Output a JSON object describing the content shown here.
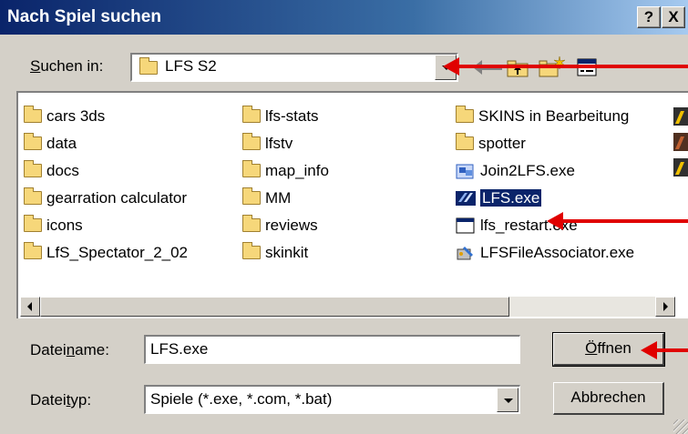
{
  "window": {
    "title": "Nach Spiel suchen",
    "help_label": "?",
    "close_label": "X"
  },
  "lookin": {
    "label_prefix": "S",
    "label_rest": "uchen in:",
    "value": "LFS S2"
  },
  "toolbar_icons": [
    "back-arrow-icon",
    "up-folder-icon",
    "new-folder-icon",
    "view-menu-icon"
  ],
  "files": {
    "col1": [
      "cars 3ds",
      "data",
      "docs",
      "gearration calculator",
      "icons",
      "LfS_Spectator_2_02"
    ],
    "col2": [
      "lfs-stats",
      "lfstv",
      "map_info",
      "MM",
      "reviews",
      "skinkit"
    ],
    "col3": [
      {
        "name": "SKINS in Bearbeitung",
        "icon": "folder-icon"
      },
      {
        "name": "spotter",
        "icon": "folder-icon"
      },
      {
        "name": "Join2LFS.exe",
        "icon": "exe-icon"
      },
      {
        "name": "LFS.exe",
        "icon": "lfs-exe-icon",
        "selected": true
      },
      {
        "name": "lfs_restart.exe",
        "icon": "window-exe-icon"
      },
      {
        "name": "LFSFileAssociator.exe",
        "icon": "tools-exe-icon"
      }
    ]
  },
  "filename": {
    "label_a": "Datei",
    "label_u": "n",
    "label_b": "ame:",
    "value": "LFS.exe"
  },
  "filetype": {
    "label_a": "Datei",
    "label_u": "t",
    "label_b": "yp:",
    "value": "Spiele (*.exe, *.com, *.bat)"
  },
  "buttons": {
    "open_u": "Ö",
    "open_rest": "ffnen",
    "cancel": "Abbrechen"
  },
  "colors": {
    "annotation_arrow": "#e00000",
    "title_bar": "#0a246a",
    "selection": "#0a246a"
  }
}
